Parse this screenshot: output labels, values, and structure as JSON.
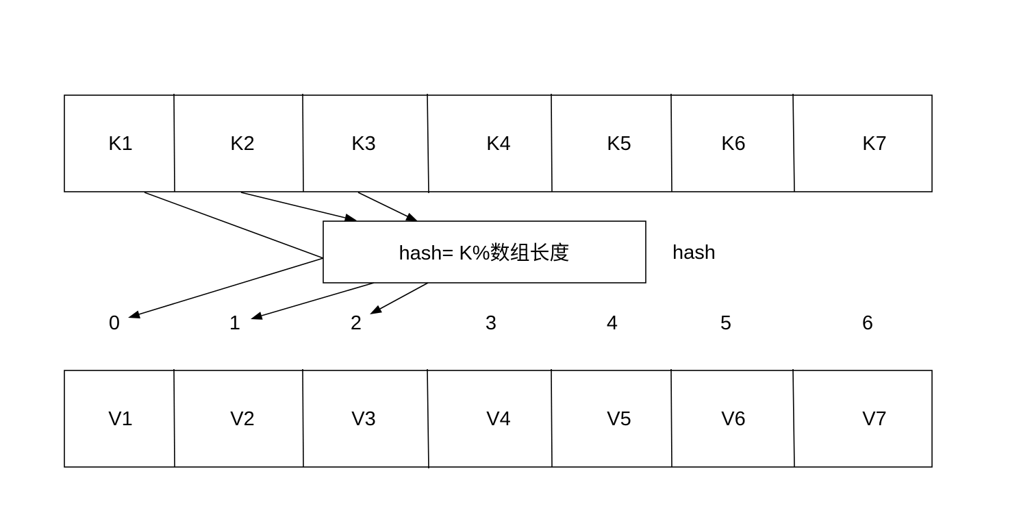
{
  "keys_row": {
    "cells": [
      "K1",
      "K2",
      "K3",
      "K4",
      "K5",
      "K6",
      "K7"
    ]
  },
  "hash_function": {
    "box_label": "hash= K%数组长度",
    "side_label": "hash"
  },
  "indices": [
    "0",
    "1",
    "2",
    "3",
    "4",
    "5",
    "6"
  ],
  "values_row": {
    "cells": [
      "V1",
      "V2",
      "V3",
      "V4",
      "V5",
      "V6",
      "V7"
    ]
  },
  "arrows": [
    {
      "from": "K1",
      "to": "0"
    },
    {
      "from": "K2",
      "to": "1"
    },
    {
      "from": "K3",
      "to": "2"
    }
  ],
  "colors": {
    "stroke": "#000000",
    "background": "#ffffff"
  }
}
